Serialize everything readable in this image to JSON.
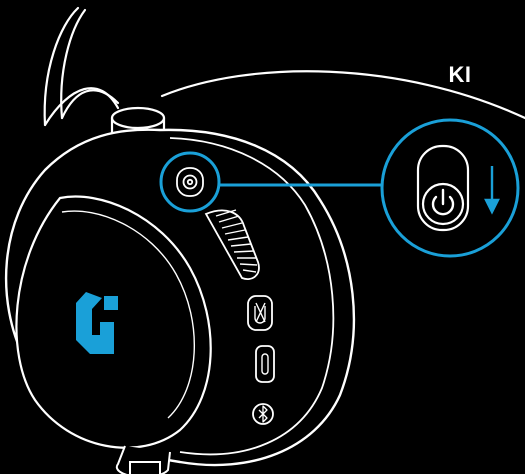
{
  "callout": {
    "label": "KI"
  },
  "icons": {
    "power": "power-icon",
    "arrow": "arrow-down-icon",
    "logo": "logitech-g-logo",
    "mic_mute": "mic-mute-icon",
    "usb": "usb-c-port-icon",
    "bluetooth": "bluetooth-icon"
  },
  "colors": {
    "background": "#000000",
    "line": "#ffffff",
    "callout_accent": "#1aa0d8"
  }
}
